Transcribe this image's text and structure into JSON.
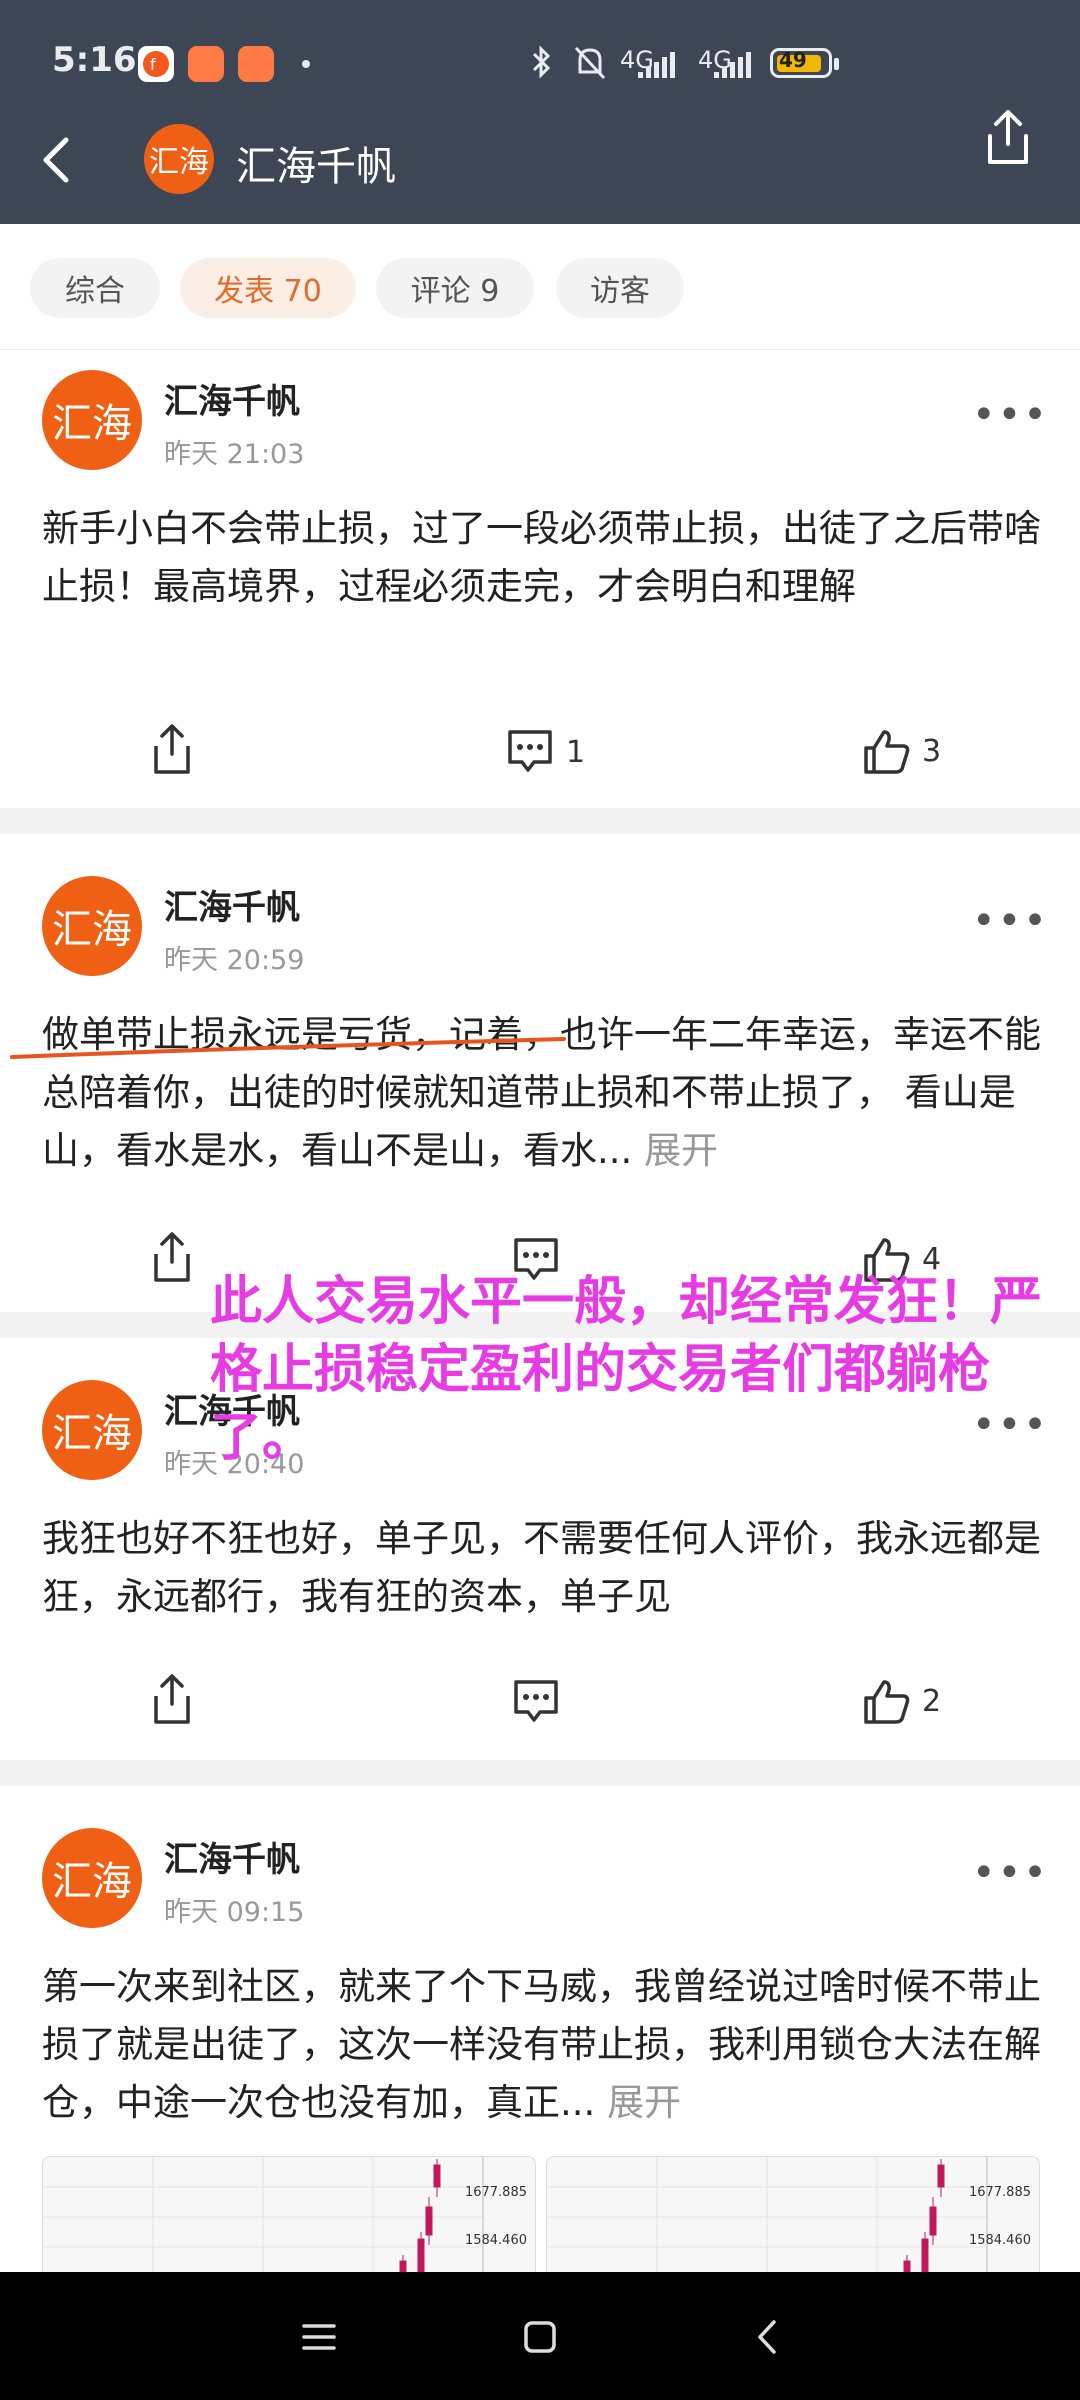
{
  "status_bar": {
    "time": "5:16",
    "network1": "4G",
    "network2": "4G",
    "battery": "49"
  },
  "header": {
    "avatar_text": "汇海",
    "title": "汇海千帆"
  },
  "tabs": [
    {
      "label": "综合"
    },
    {
      "label": "发表 70"
    },
    {
      "label": "评论 9"
    },
    {
      "label": "访客"
    }
  ],
  "posts": [
    {
      "avatar_text": "汇海",
      "author": "汇海千帆",
      "time": "昨天 21:03",
      "text": "新手小白不会带止损，过了一段必须带止损，出徒了之后带啥止损！最高境界，过程必须走完，才会明白和理解",
      "comments": "1",
      "likes": "3"
    },
    {
      "avatar_text": "汇海",
      "author": "汇海千帆",
      "time": "昨天 20:59",
      "text": "做单带止损永远是亏货，记着，也许一年二年幸运，幸运不能总陪着你，出徒的时候就知道带止损和不带止损了， 看山是山，看水是水，看山不是山，看水...",
      "expand": "展开",
      "comments": "",
      "likes": "4"
    },
    {
      "avatar_text": "汇海",
      "author": "汇海千帆",
      "time": "昨天 20:40",
      "text": "我狂也好不狂也好，单子见，不需要任何人评价，我永远都是狂，永远都行，我有狂的资本，单子见",
      "comments": "",
      "likes": "2"
    },
    {
      "avatar_text": "汇海",
      "author": "汇海千帆",
      "time": "昨天 09:15",
      "text": "第一次来到社区，就来了个下马威，我曾经说过啥时候不带止损了就是出徒了，这次一样没有带止损，我利用锁仓大法在解仓，中途一次仓也没有加，真正...",
      "expand": "展开"
    }
  ],
  "overlay_text": "此人交易水平一般，却经常发狂！严格止损稳定盈利的交易者们都躺枪了。",
  "chart_labels": {
    "upper": "1677.885",
    "lower": "1584.460"
  },
  "colors": {
    "header_bg": "#3d4654",
    "accent": "#e56a2c",
    "avatar": "#f06014",
    "overlay": "#e73ce3"
  }
}
